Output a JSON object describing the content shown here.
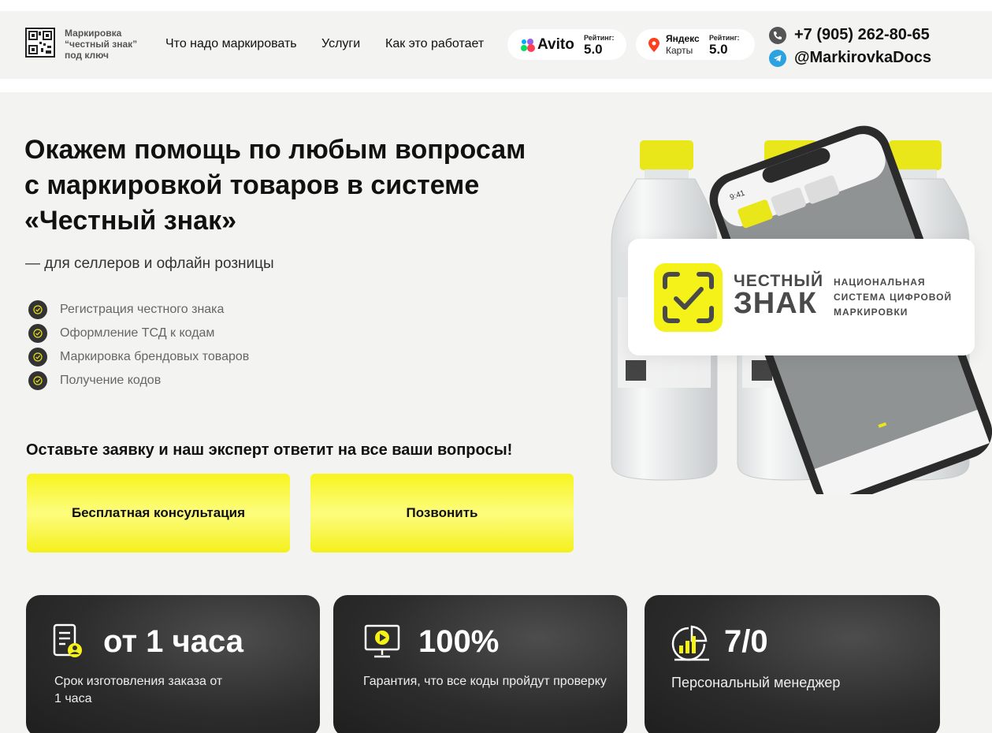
{
  "header": {
    "logo_text": "Маркировка “честный знак” под ключ",
    "nav": [
      "Что надо маркировать",
      "Услуги",
      "Как это работает"
    ],
    "avito": {
      "name": "Avito",
      "rating_label": "Рейтинг:",
      "rating": "5.0"
    },
    "yandex": {
      "name_line1": "Яндекс",
      "name_line2": "Карты",
      "rating_label": "Рейтинг:",
      "rating": "5.0"
    },
    "phone": "+7 (905) 262-80-65",
    "telegram": "@MarkirovkaDocs"
  },
  "hero": {
    "title_line1": "Окажем помощь по любым вопросам",
    "title_line2": "с маркировкой товаров в системе",
    "title_line3": "«Честный знак»",
    "subtitle": "— для селлеров и офлайн розницы",
    "features": [
      "Регистрация честного знака",
      "Оформление ТСД к кодам",
      "Маркировка брендовых товаров",
      "Получение кодов"
    ],
    "cta_title": "Оставьте заявку и наш эксперт ответит на все ваши вопросы!",
    "btn_consult": "Бесплатная консультация",
    "btn_call": "Позвонить"
  },
  "brand": {
    "name_line1": "ЧЕСТНЫЙ",
    "name_line2": "ЗНАК",
    "desc_line1": "НАЦИОНАЛЬНАЯ",
    "desc_line2": "СИСТЕМА ЦИФРОВОЙ",
    "desc_line3": "МАРКИРОВКИ",
    "phone_time": "9:41"
  },
  "stats": [
    {
      "value": "от 1 часа",
      "desc_line1": "Срок изготовления заказа от",
      "desc_line2": "1 часа",
      "icon": "document-user-icon"
    },
    {
      "value": "100%",
      "desc_line1": "Гарантия, что все коды пройдут проверку",
      "desc_line2": "",
      "icon": "monitor-play-icon"
    },
    {
      "value": "7/0",
      "desc_line1": "Персональный менеджер",
      "desc_line2": "",
      "icon": "chart-growth-icon"
    }
  ],
  "colors": {
    "accent_yellow": "#f5f21a",
    "dark_card": "#2c2c2c",
    "brand_grey": "#4a4a4a",
    "telegram": "#2aa3e0"
  }
}
